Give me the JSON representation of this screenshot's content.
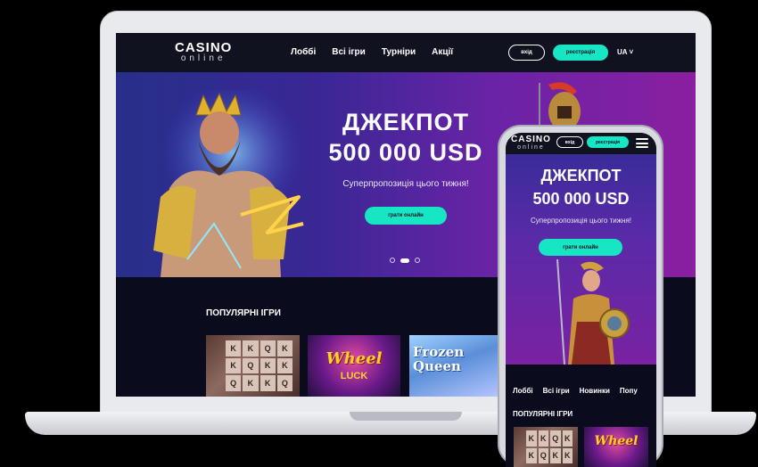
{
  "desktop": {
    "logo": {
      "line1": "CASINO",
      "line2": "online"
    },
    "nav": [
      "Лоббі",
      "Всі ігри",
      "Турніри",
      "Акції"
    ],
    "login_label": "вхід",
    "register_label": "реєстрація",
    "language": "UA ˅",
    "hero": {
      "title_line1": "ДЖЕКПОТ",
      "title_line2": "500 000 USD",
      "subtitle": "Суперпропозиція цього тижня!",
      "cta_label": "грати онлайн",
      "slide_count": 3,
      "active_slide": 2
    },
    "popular": {
      "title": "ПОПУЛЯРНІ ІГРИ",
      "games": [
        {
          "id": "slots",
          "symbols": [
            "K",
            "K",
            "Q",
            "K",
            "K",
            "Q",
            "K",
            "K",
            "Q",
            "K",
            "K",
            "Q"
          ]
        },
        {
          "id": "wheel",
          "name_line1": "Wheel",
          "name_line2": "LUCK"
        },
        {
          "id": "frozen",
          "name_line1": "Frozen",
          "name_line2": "Queen"
        }
      ]
    }
  },
  "mobile": {
    "logo": {
      "line1": "CASINO",
      "line2": "online"
    },
    "login_label": "вхід",
    "register_label": "реєстрація",
    "hero": {
      "title_line1": "ДЖЕКПОТ",
      "title_line2": "500 000 USD",
      "subtitle": "Суперпропозиція цього тижня!",
      "cta_label": "грати онлайн"
    },
    "nav": [
      "Лоббі",
      "Всі ігри",
      "Новинки",
      "Попу"
    ],
    "popular_title": "ПОПУЛЯРНІ ІГРИ",
    "game2_name": "Wheel"
  },
  "colors": {
    "accent": "#16e6c4",
    "header_bg": "#10131f",
    "page_bg": "#0a0c1e",
    "hero_left": "#272f8a",
    "hero_right": "#8a1fa0"
  }
}
